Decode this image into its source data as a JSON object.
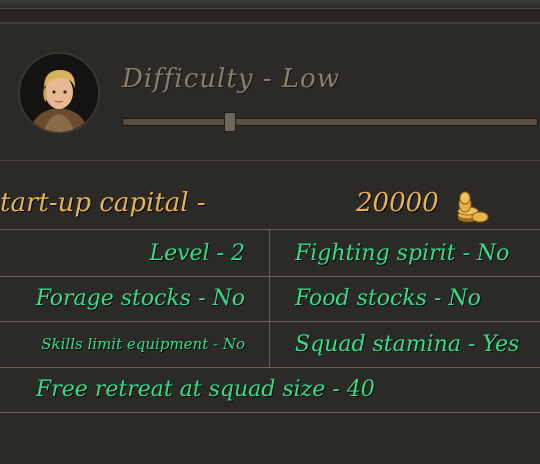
{
  "difficulty": {
    "title": "Difficulty - Low",
    "level_fraction": 0.26
  },
  "capital": {
    "label": "tart-up capital -",
    "value": "20000",
    "icon": "gold-coins-icon"
  },
  "settings": {
    "level": "Level - 2",
    "fighting_spirit": "Fighting spirit - No",
    "forage_stocks": "Forage stocks - No",
    "food_stocks": "Food stocks - No",
    "skills_limit": "Skills limit equipment - No",
    "squad_stamina": "Squad stamina - Yes",
    "free_retreat": "Free retreat at squad size - 40"
  },
  "colors": {
    "gold": "#e8b34b",
    "green": "#2fe08a",
    "muted": "#8a7d6c"
  }
}
